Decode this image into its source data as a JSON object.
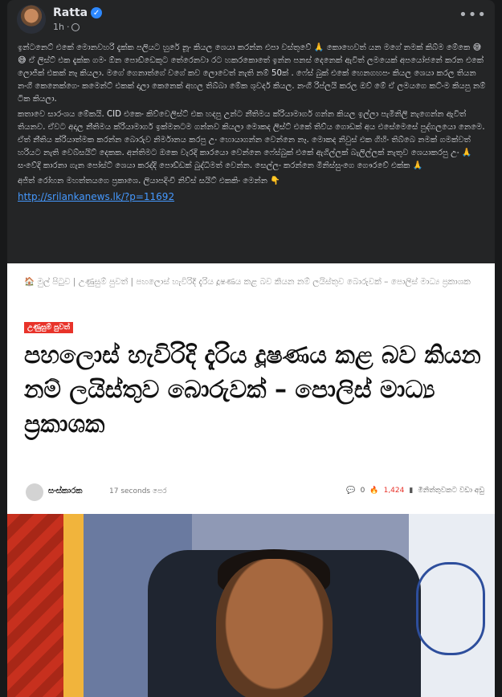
{
  "post": {
    "author": "Ratta",
    "time": "1h",
    "verified_icon": "verified-badge-icon",
    "privacy_icon": "globe-icon",
    "more_icon": "more-options-icon",
    "paragraphs": [
      "ඉන්ටනෙට් එකේ මොනවහරි දැක්ක පලියට හුරේ නූං කියල ශෙයා කරන්න එපා වස්තුවේ 🙏 කොහෙවත් යන මගේ නමක් කිබ්ම මේකෙ 😅😅 ඒ ලිස්ට් එක දැක්ක ගමං ඕන පොඩ්ඩෙකුට තේරෙනවා රට හකරකොතේ ඉන්න පනස් දෙනෙක් ඇවිත් ලමයෙක් අපයෝජනේ කරන එකේ ලොජික් එකක් නෑ කියලා. මගේ ගෙනාත්ගේ වගේ කව ලොවෙත් නැති නම් 50ක් . ෆේස් බුක් එකේ හෙනගහපං කියල ශෙයා කරල තියන නංගී කෙනෙක්ගෙං කමෙන්ට් එකක් දාලා කෙනෙක් අහල තිබ්බා මේක ශුවර්ද කියල. නංගී රිප්ලයි කරල ඔව් මේ ඒ ලමයගෙ කට්ංම කියපු නම් ටික කියලා.",
      "කතාවෙ සාරංශය මේකයි. CID එකෙං කිව්වෙලිස්ට් එක හදපු  උන්ට නීතිමය ක්රියාමාර්ග ගන්න කියල ඉල්ලා පැමිනිලි නැගෙන්න ඇවිත් තියනව. ඒවට අදාල නීතිමය ක්රියාමාර්ග ඉක්මනටම ගන්නව කියලා මොකද ලිස්ට් එකේ තිව්ය ගොඩක් අය එසේමෙසේ පුද්ගලයො නෙමෙ. ඒත් නීතිය ක්රියාත්මක කරන්න බොරුව නිර්මානය කරපු උං හොයාගන්න වෙන්නෙ නෑ. මොකද නිවුස් එක ගිහිං තිබ්බෙ නමක් ගමක්වත් හරියට නැති වෙබ්සයිට් දෙකක. අන්තිමට ඔකෙ වැරදි කාරයො වෙන්නෙ ෆේස්බුක් එකේ ඇගිල්ලක් බැලිල්ලක් නැතුව ශෙයාකරපු උං 🙏 සංවේදි කාරනා ගැන පෝස්ට් ශෙයා කරද්දි පොඩ්ඩක් බුද්ධිමත් වෙන්න. සෙල්ලං කරන්නෙ මිනිස්සුංගෙ ගෞරවේ එක්ක 🙏",
      "අජිත් රෝහන මහත්තයගෙ ප්‍රකාශෙ. ලියාපදිංචි නිව්ස් සයිට් එකකිං මෙන්න 👇"
    ],
    "link": "http://srilankanews.lk/?p=11692"
  },
  "shared": {
    "breadcrumb": "🏠 මුල් පිටුව | උණුසුම් පුවත් | පහලොස් හැවිරිදි දැරිය දූෂණය කළ බව කියන නම් ලයිස්තුව බොරුවක් – පොලිස් මාධ්‍ය ප්‍රකාශක",
    "tag": "උණුසුම් පුවත්",
    "headline": "පහලොස් හැවිරිදි දැරිය දූෂණය කළ බව කියන නම් ලයිස්තුව බොරුවක් – පොලිස් මාධ්‍ය ප්‍රකාශක",
    "author": "සංස්කාරක",
    "time": "17 seconds පෙර",
    "comments": "0",
    "views": "1,424",
    "read_time": "මිනිත්තුවකට වඩා අඩු"
  }
}
